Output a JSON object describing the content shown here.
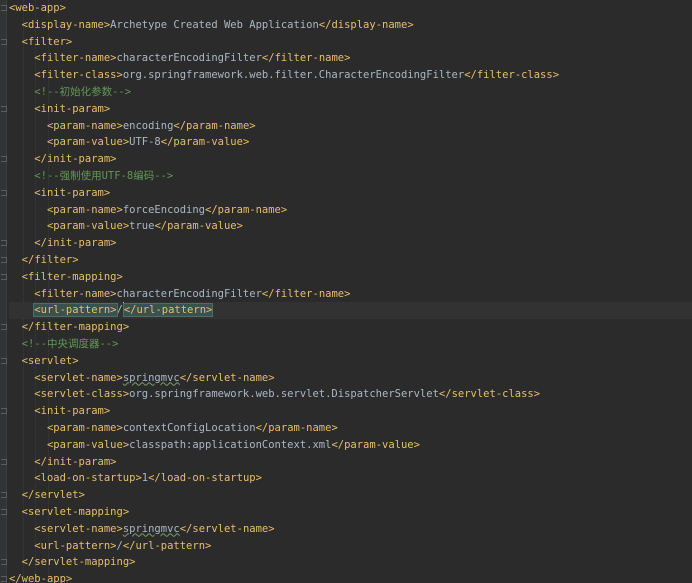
{
  "editor": {
    "colors": {
      "background": "#2b2b2b",
      "tag": "#e8bf6a",
      "text": "#a9b7c6",
      "comment": "#629755",
      "current_line": "#323232"
    },
    "lines": [
      {
        "indent": 0,
        "type": "open",
        "tag": "web-app",
        "fold": true
      },
      {
        "indent": 1,
        "type": "element",
        "tag": "display-name",
        "text": "Archetype Created Web Application"
      },
      {
        "indent": 1,
        "type": "open",
        "tag": "filter",
        "fold": true
      },
      {
        "indent": 2,
        "type": "element",
        "tag": "filter-name",
        "text": "characterEncodingFilter"
      },
      {
        "indent": 2,
        "type": "element",
        "tag": "filter-class",
        "text": "org.springframework.web.filter.CharacterEncodingFilter"
      },
      {
        "indent": 2,
        "type": "comment",
        "text": "<!--初始化参数-->"
      },
      {
        "indent": 2,
        "type": "open",
        "tag": "init-param",
        "fold": true
      },
      {
        "indent": 3,
        "type": "element",
        "tag": "param-name",
        "text": "encoding"
      },
      {
        "indent": 3,
        "type": "element",
        "tag": "param-value",
        "text": "UTF-8"
      },
      {
        "indent": 2,
        "type": "close",
        "tag": "init-param",
        "fold": true
      },
      {
        "indent": 2,
        "type": "comment",
        "text": "<!--强制使用UTF-8编码-->"
      },
      {
        "indent": 2,
        "type": "open",
        "tag": "init-param",
        "fold": true
      },
      {
        "indent": 3,
        "type": "element",
        "tag": "param-name",
        "text": "forceEncoding"
      },
      {
        "indent": 3,
        "type": "element",
        "tag": "param-value",
        "text": "true"
      },
      {
        "indent": 2,
        "type": "close",
        "tag": "init-param",
        "fold": true
      },
      {
        "indent": 1,
        "type": "close",
        "tag": "filter",
        "fold": true
      },
      {
        "indent": 1,
        "type": "open",
        "tag": "filter-mapping",
        "fold": true
      },
      {
        "indent": 2,
        "type": "element",
        "tag": "filter-name",
        "text": "characterEncodingFilter"
      },
      {
        "indent": 2,
        "type": "element",
        "tag": "url-pattern",
        "text": "/",
        "current": true
      },
      {
        "indent": 1,
        "type": "close",
        "tag": "filter-mapping",
        "fold": true
      },
      {
        "indent": 1,
        "type": "comment",
        "text": "<!--中央调度器-->"
      },
      {
        "indent": 1,
        "type": "open",
        "tag": "servlet",
        "fold": true
      },
      {
        "indent": 2,
        "type": "element",
        "tag": "servlet-name",
        "text": "springmvc",
        "squiggle": true
      },
      {
        "indent": 2,
        "type": "element",
        "tag": "servlet-class",
        "text": "org.springframework.web.servlet.DispatcherServlet"
      },
      {
        "indent": 2,
        "type": "open",
        "tag": "init-param",
        "fold": true
      },
      {
        "indent": 3,
        "type": "element",
        "tag": "param-name",
        "text": "contextConfigLocation"
      },
      {
        "indent": 3,
        "type": "element",
        "tag": "param-value",
        "text": "classpath:applicationContext.xml"
      },
      {
        "indent": 2,
        "type": "close",
        "tag": "init-param",
        "fold": true
      },
      {
        "indent": 2,
        "type": "element",
        "tag": "load-on-startup",
        "text": "1"
      },
      {
        "indent": 1,
        "type": "close",
        "tag": "servlet",
        "fold": true
      },
      {
        "indent": 1,
        "type": "open",
        "tag": "servlet-mapping",
        "fold": true
      },
      {
        "indent": 2,
        "type": "element",
        "tag": "servlet-name",
        "text": "springmvc",
        "squiggle": true
      },
      {
        "indent": 2,
        "type": "element",
        "tag": "url-pattern",
        "text": "/"
      },
      {
        "indent": 1,
        "type": "close",
        "tag": "servlet-mapping",
        "fold": true
      },
      {
        "indent": 0,
        "type": "close",
        "tag": "web-app",
        "fold": true
      }
    ]
  }
}
